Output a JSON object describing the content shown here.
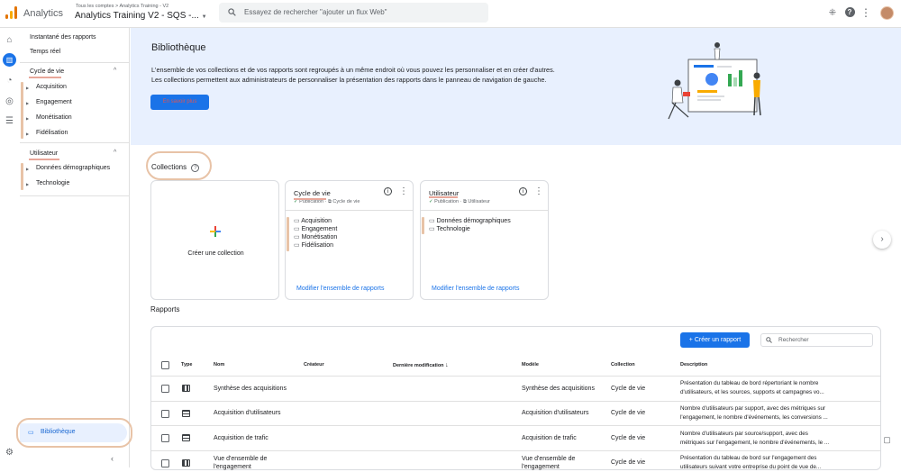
{
  "topbar": {
    "app_name": "Analytics",
    "breadcrumb": "Tous les comptes > Analytics Training - V2",
    "property": "Analytics Training V2 - SQS -...",
    "search_placeholder": "Essayez de rechercher \"ajouter un flux Web\""
  },
  "nav": {
    "snapshot": "Instantané des rapports",
    "realtime": "Temps réel",
    "lifecycle": {
      "heading": "Cycle de vie",
      "items": [
        "Acquisition",
        "Engagement",
        "Monétisation",
        "Fidélisation"
      ]
    },
    "user": {
      "heading": "Utilisateur",
      "items": [
        "Données démographiques",
        "Technologie"
      ]
    },
    "library": "Bibliothèque"
  },
  "hero": {
    "title": "Bibliothèque",
    "line1": "L'ensemble de vos collections et de vos rapports sont regroupés à un même endroit où vous pouvez les personnaliser et en créer d'autres.",
    "line2": "Les collections permettent aux administrateurs de personnaliser la présentation des rapports dans le panneau de navigation de gauche.",
    "button": "En savoir plus"
  },
  "collections": {
    "heading": "Collections",
    "create_label": "Créer une collection",
    "cards": [
      {
        "title": "Cycle de vie",
        "status": "Publication",
        "template": "Cycle de vie",
        "folders": [
          "Acquisition",
          "Engagement",
          "Monétisation",
          "Fidélisation"
        ],
        "link": "Modifier l'ensemble de rapports"
      },
      {
        "title": "Utilisateur",
        "status": "Publication",
        "template": "Utilisateur",
        "folders": [
          "Données démographiques",
          "Technologie"
        ],
        "link": "Modifier l'ensemble de rapports"
      }
    ]
  },
  "reports": {
    "heading": "Rapports",
    "create_button": "Créer un rapport",
    "search_placeholder": "Rechercher",
    "columns": [
      "Type",
      "Nom",
      "Créateur",
      "Dernière modification",
      "Modèle",
      "Collection",
      "Description"
    ],
    "rows": [
      {
        "name": "Synthèse des acquisitions",
        "model": "Synthèse des acquisitions",
        "collection": "Cycle de vie",
        "desc1": "Présentation du tableau de bord répertoriant le nombre",
        "desc2": "d'utilisateurs, et les sources, supports et campagnes vo..."
      },
      {
        "name": "Acquisition d'utilisateurs",
        "model": "Acquisition d'utilisateurs",
        "collection": "Cycle de vie",
        "desc1": "Nombre d'utilisateurs par support, avec des métriques sur",
        "desc2": "l'engagement, le nombre d'événements, les conversions ..."
      },
      {
        "name": "Acquisition de trafic",
        "model": "Acquisition de trafic",
        "collection": "Cycle de vie",
        "desc1": "Nombre d'utilisateurs par source/support, avec des",
        "desc2": "métriques sur l'engagement, le nombre d'événements, le ..."
      },
      {
        "name": "Vue d'ensemble de",
        "name2": "l'engagement",
        "model": "Vue d'ensemble de",
        "model2": "l'engagement",
        "collection": "Cycle de vie",
        "desc1": "Présentation du tableau de bord sur l'engagement des",
        "desc2": "utilisateurs suivant votre entreprise du point de vue de..."
      }
    ]
  }
}
